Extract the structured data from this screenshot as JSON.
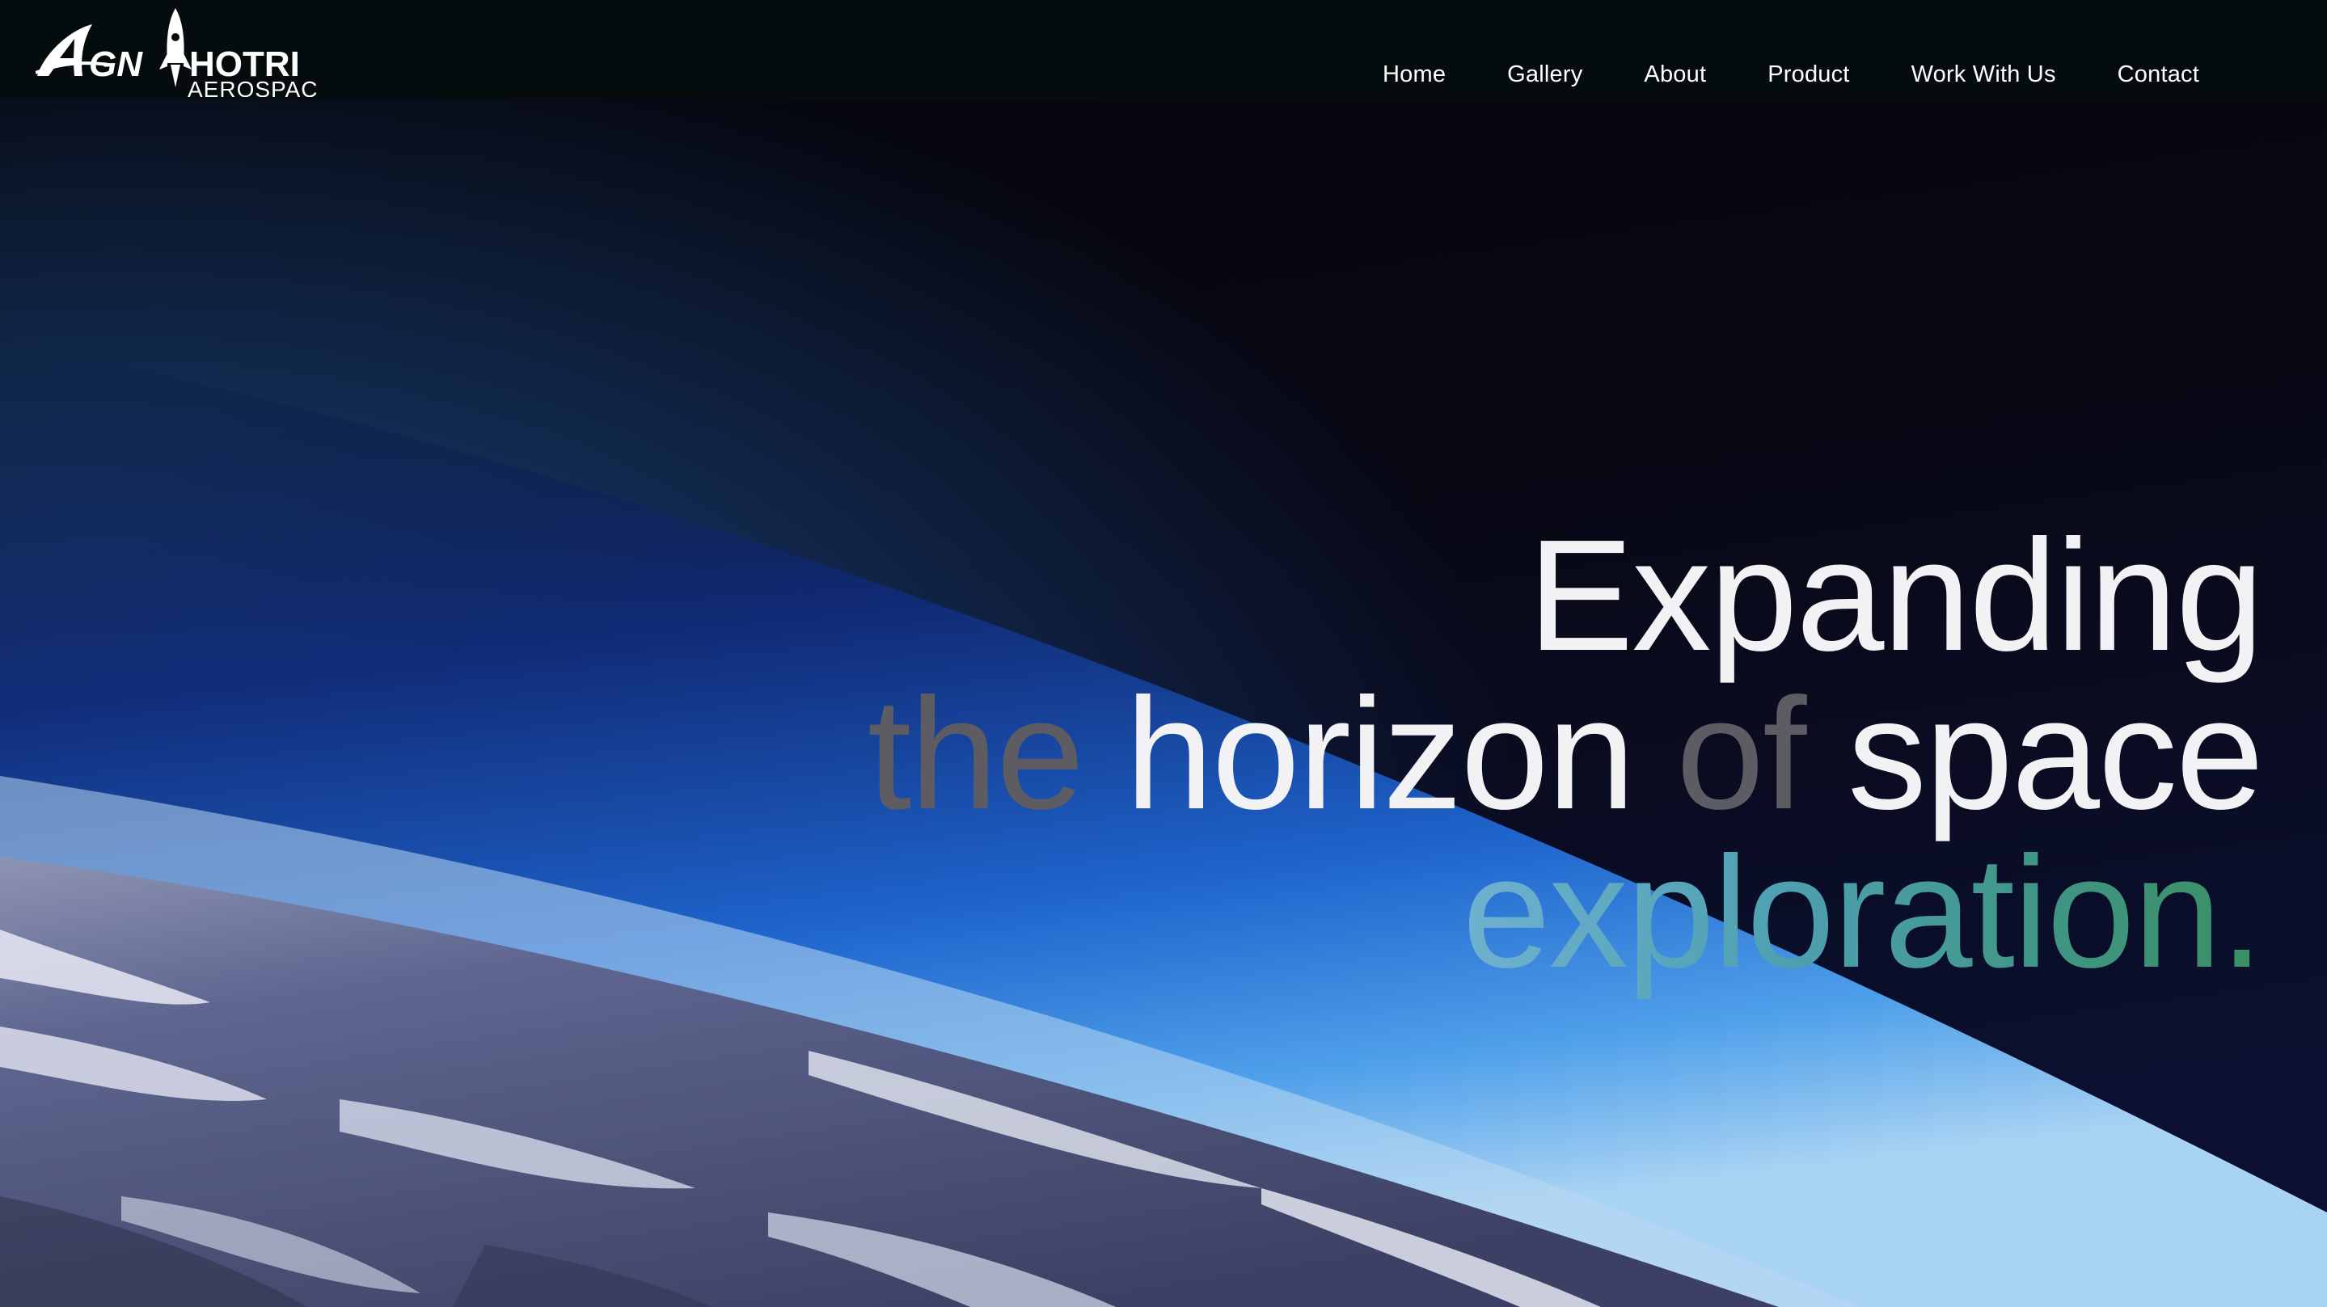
{
  "brand": {
    "logo_main": "AGNIHOTRI",
    "logo_sub": "AEROSPACE"
  },
  "nav": {
    "items": [
      {
        "label": "Home"
      },
      {
        "label": "Gallery"
      },
      {
        "label": "About"
      },
      {
        "label": "Product"
      },
      {
        "label": "Work With Us"
      },
      {
        "label": "Contact"
      }
    ]
  },
  "hero": {
    "line1": {
      "word1": "Expanding"
    },
    "line2": {
      "word1": "the",
      "word2": "horizon",
      "word3": "of",
      "word4": "space"
    },
    "line3": {
      "word1": "exploration."
    }
  },
  "colors": {
    "navbar_bg": "#050c0d",
    "text_white": "#f2f2f4",
    "text_gray": "#5d5c63",
    "gradient_start": "#6fb1d0",
    "gradient_end": "#3b8f62",
    "space_dark": "#07070d",
    "atmosphere_blue": "#1f6fd6"
  },
  "icons": {
    "logo_rocket": "rocket-icon"
  }
}
